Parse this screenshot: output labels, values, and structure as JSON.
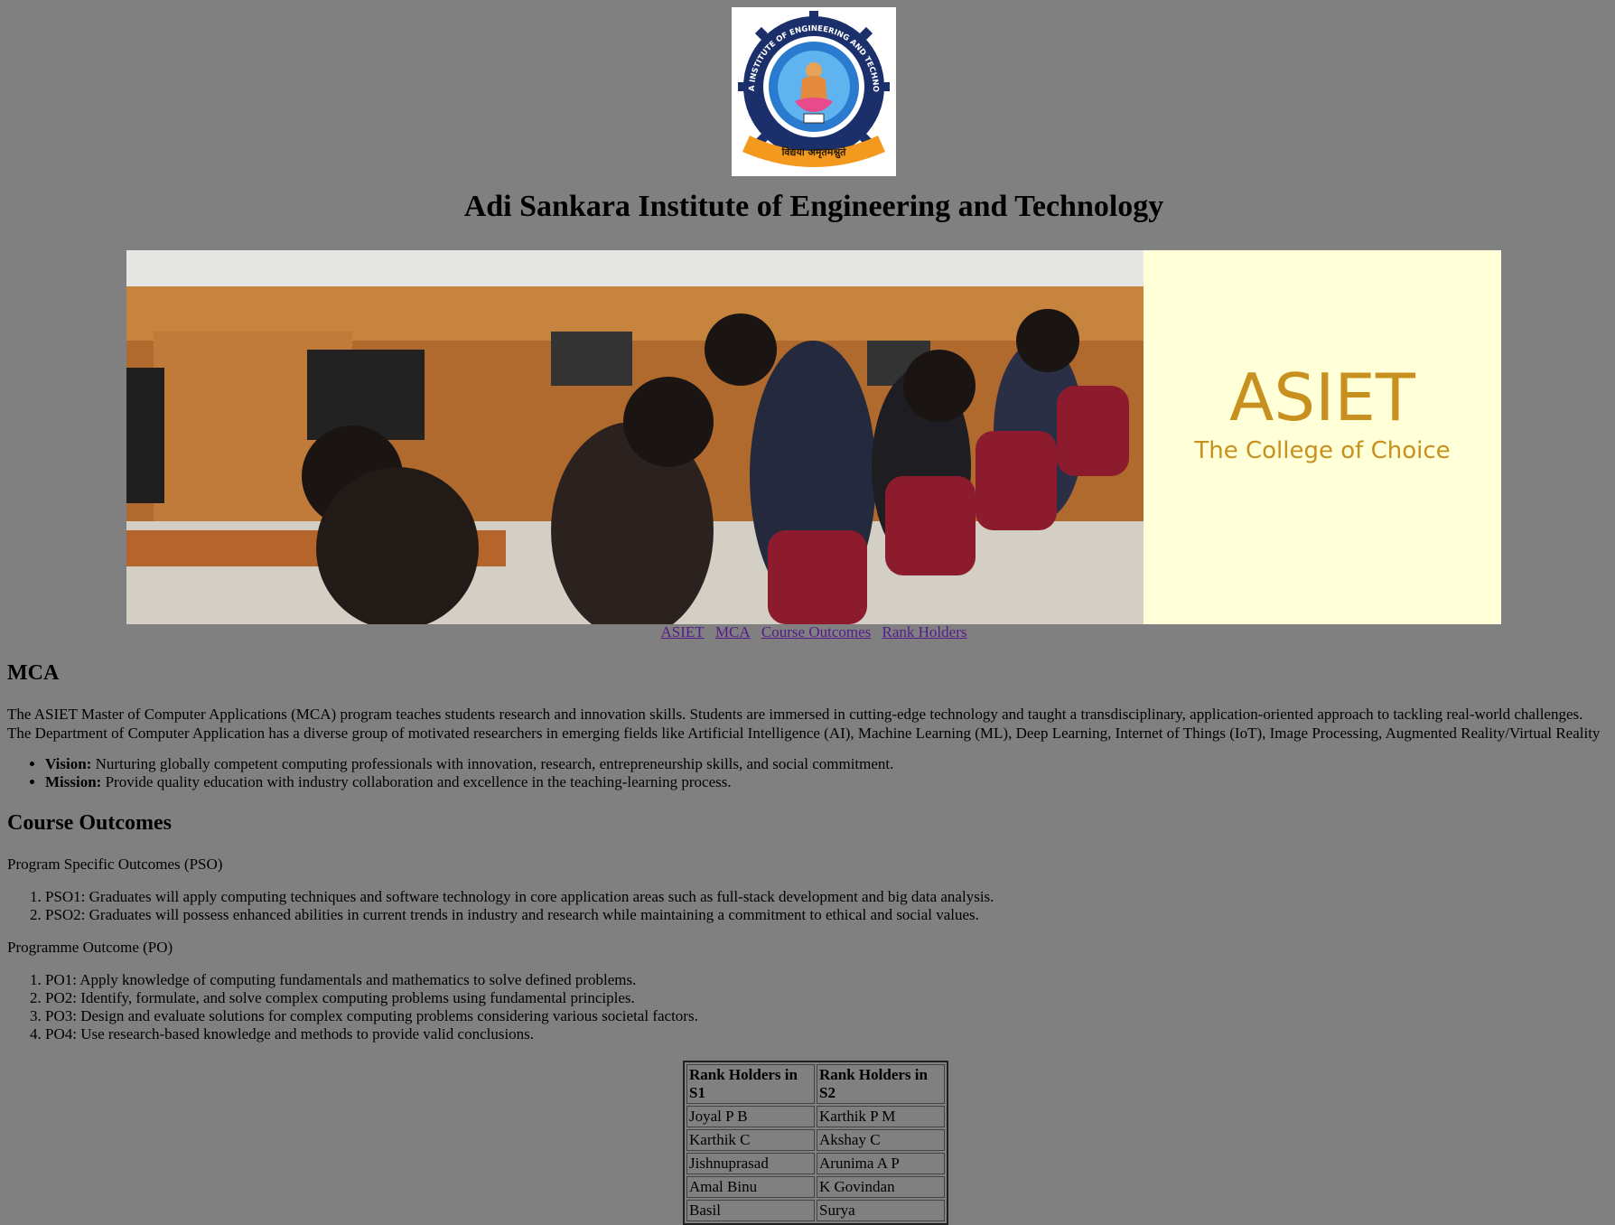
{
  "site": {
    "title": "Adi Sankara Institute of Engineering and Technology",
    "logo": {
      "ring_text": "ADI SHANKARA INSTITUTE OF ENGINEERING AND TECHNOLOGY, KALADI",
      "motto": "विद्यया अमृतमश्नुते"
    }
  },
  "banner": {
    "brand": "ASIET",
    "tagline": "The College of Choice"
  },
  "nav": {
    "links": [
      "ASIET",
      "MCA",
      "Course Outcomes",
      "Rank Holders"
    ]
  },
  "mca": {
    "heading": "MCA",
    "intro": "The ASIET Master of Computer Applications (MCA) program teaches students research and innovation skills. Students are immersed in cutting-edge technology and taught a transdisciplinary, application-oriented approach to tackling real-world challenges. The Department of Computer Application has a diverse group of motivated researchers in emerging fields like Artificial Intelligence (AI), Machine Learning (ML), Deep Learning, Internet of Things (IoT), Image Processing, Augmented Reality/Virtual Reality",
    "points": [
      {
        "label": "Vision:",
        "text": " Nurturing globally competent computing professionals with innovation, research, entrepreneurship skills, and social commitment."
      },
      {
        "label": "Mission:",
        "text": " Provide quality education with industry collaboration and excellence in the teaching-learning process."
      }
    ]
  },
  "outcomes": {
    "heading": "Course Outcomes",
    "pso_heading": "Program Specific Outcomes (PSO)",
    "pso": [
      "PSO1: Graduates will apply computing techniques and software technology in core application areas such as full-stack development and big data analysis.",
      "PSO2: Graduates will possess enhanced abilities in current trends in industry and research while maintaining a commitment to ethical and social values."
    ],
    "po_heading": "Programme Outcome (PO)",
    "po": [
      "PO1: Apply knowledge of computing fundamentals and mathematics to solve defined problems.",
      "PO2: Identify, formulate, and solve complex computing problems using fundamental principles.",
      "PO3: Design and evaluate solutions for complex computing problems considering various societal factors.",
      "PO4: Use research-based knowledge and methods to provide valid conclusions."
    ]
  },
  "rank_holders": {
    "headers": [
      "Rank Holders in S1",
      "Rank Holders in S2"
    ],
    "rows": [
      [
        "Joyal P B",
        "Karthik P M"
      ],
      [
        "Karthik C",
        "Akshay C"
      ],
      [
        "Jishnuprasad",
        "Arunima A P"
      ],
      [
        "Amal Binu",
        "K Govindan"
      ],
      [
        "Basil",
        "Surya"
      ]
    ]
  },
  "colors": {
    "page_bg": "#808080",
    "link": "#551a8b",
    "banner_panel": "#ffffd8",
    "brand_gold": "#c8901e"
  }
}
